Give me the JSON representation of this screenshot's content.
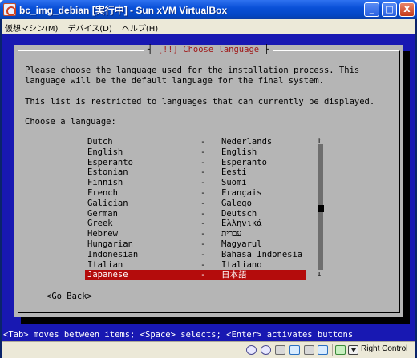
{
  "window": {
    "title": "bc_img_debian [実行中] - Sun xVM VirtualBox",
    "minimize_glyph": "_",
    "maximize_glyph": "□",
    "close_glyph": "X"
  },
  "menubar": {
    "items": [
      {
        "label": "仮想マシン(M)"
      },
      {
        "label": "デバイス(D)"
      },
      {
        "label": "ヘルプ(H)"
      }
    ]
  },
  "dialog": {
    "title": "[!!] Choose language",
    "title_left": "┤",
    "title_right": "├",
    "intro_line1": "Please choose the language used for the installation process. This",
    "intro_line2": "language will be the default language for the final system.",
    "restriction": "This list is restricted to languages that can currently be displayed.",
    "prompt": "Choose a language:",
    "go_back": "<Go Back>",
    "scroll_up": "↑",
    "scroll_down": "↓",
    "languages": [
      {
        "name": "Dutch",
        "dash": "-",
        "native": "Nederlands"
      },
      {
        "name": "English",
        "dash": "-",
        "native": "English"
      },
      {
        "name": "Esperanto",
        "dash": "-",
        "native": "Esperanto"
      },
      {
        "name": "Estonian",
        "dash": "-",
        "native": "Eesti"
      },
      {
        "name": "Finnish",
        "dash": "-",
        "native": "Suomi"
      },
      {
        "name": "French",
        "dash": "-",
        "native": "Français"
      },
      {
        "name": "Galician",
        "dash": "-",
        "native": "Galego"
      },
      {
        "name": "German",
        "dash": "-",
        "native": "Deutsch"
      },
      {
        "name": "Greek",
        "dash": "-",
        "native": "Ελληνικά"
      },
      {
        "name": "Hebrew",
        "dash": "-",
        "native": "עברית"
      },
      {
        "name": "Hungarian",
        "dash": "-",
        "native": "Magyarul"
      },
      {
        "name": "Indonesian",
        "dash": "-",
        "native": "Bahasa Indonesia"
      },
      {
        "name": "Italian",
        "dash": "-",
        "native": "Italiano"
      },
      {
        "name": "Japanese",
        "dash": "-",
        "native": "日本語",
        "selected": true
      }
    ]
  },
  "footer_hint": "<Tab> moves between items; <Space> selects; <Enter> activates buttons",
  "statusbar": {
    "host_key": "Right Control"
  },
  "colors": {
    "vm_background": "#1818b2",
    "dialog_background": "#b5b5b5",
    "selection": "#b40c0c",
    "title_text": "#a01818"
  }
}
